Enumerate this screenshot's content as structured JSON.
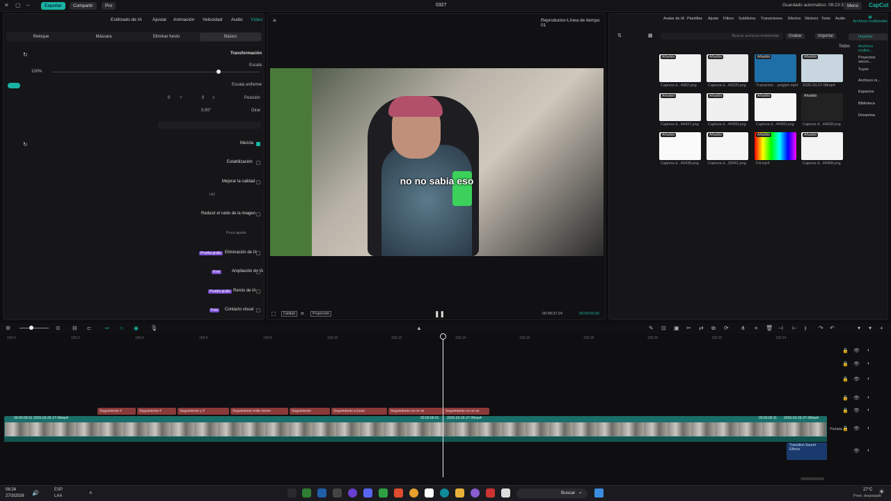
{
  "titlebar": {
    "export": "Exportar",
    "share": "Compartir",
    "pro": "Pro",
    "title": "0327",
    "autosave": "Guardado automático: 08:23:38",
    "menu": "Menú",
    "brand": "CapCut"
  },
  "left_tabs": [
    "Vídeo",
    "Audio",
    "Velocidad",
    "Animación",
    "Ajustar",
    "Estilizado de IA"
  ],
  "left_subtabs": [
    "Básico",
    "Eliminar fondo",
    "Máscara",
    "Retoque"
  ],
  "left": {
    "transform": "Transformación",
    "scale": "Escala",
    "scale_value": "100%",
    "uniform": "Escala uniforme",
    "position": "Posición",
    "pos_x_label": "X",
    "pos_x": "0",
    "pos_y_label": "Y",
    "pos_y": "0",
    "rotate": "Girar",
    "rotate_value": "0.00°",
    "blend": "Mezcla",
    "stabilize": "Estabilización",
    "quality": "Mejorar la calidad",
    "quality_sub": "HD",
    "reduce_noise": "Reducir el ruido de la imagen",
    "noise_sub": "Poco ajuste",
    "ai_remove": "Eliminación de IA",
    "ai_remove_badge": "Prueba gratis",
    "ai_expand": "Ampliación de IA",
    "ai_expand_badge": "Free",
    "ai_remix": "Remix de IA",
    "ai_remix_badge": "Prueba gratis",
    "visual_contact": "Contacto visual",
    "visual_contact_badge": "Free"
  },
  "player": {
    "title": "Reproductor-Línea de tiempo 01",
    "subtitle": "no no sabia eso",
    "time_current": "00:00:06:05",
    "time_total": "00:08:37:24",
    "quality": "Calidad",
    "ratio": "Proporción"
  },
  "media": {
    "tabs": [
      "Importar",
      "Grabar"
    ],
    "search_placeholder": "Buscar archivos multimedia",
    "filter": "Todos",
    "top_tabs": [
      "Archivos multimedia",
      "Audio",
      "Texto",
      "Stickers",
      "Efectos",
      "Transiciones",
      "Subtítulos",
      "Filtros",
      "Ajuste",
      "Plantillas",
      "Avatar de IA"
    ],
    "side": [
      "Importar",
      "Archivos multim...",
      "Proyectos secun...",
      "Tuyos",
      "Archivos m...",
      "Espacios",
      "Biblioteca",
      "Dreamina"
    ],
    "items": [
      {
        "caption": "2026-03-27-08mp4",
        "badge": "Añadido"
      },
      {
        "caption": "Transicion ...pngtpri.mp4",
        "badge": "Añadido"
      },
      {
        "caption": "Captura d...43528.png",
        "badge": "Añadido"
      },
      {
        "caption": "Captura d...4962.png",
        "badge": "Añadido"
      },
      {
        "caption": "Captura d...44608.png",
        "badge": "Añadido"
      },
      {
        "caption": "Captura d...44455.png",
        "badge": "Añadido"
      },
      {
        "caption": "Captura d...44458.png",
        "badge": "Añadido"
      },
      {
        "caption": "Captura d...44437.png",
        "badge": "Añadido"
      },
      {
        "caption": "Captura d...44408.png",
        "badge": "Añadido"
      },
      {
        "caption": "Fili.mp4",
        "badge": "Añadido"
      },
      {
        "caption": "Captura d...30941.png",
        "badge": "Añadido"
      },
      {
        "caption": "Captura d...44438.png",
        "badge": "Añadido"
      }
    ]
  },
  "timeline": {
    "ticks": [
      "100:0",
      "100:2",
      "100:4",
      "100:6",
      "100:8",
      "100:10",
      "100:12",
      "100:14",
      "100:16",
      "100:18",
      "100:20",
      "100:22",
      "100:24"
    ],
    "captions": [
      "Seguimiento #",
      "Seguimiento #",
      "Seguimiento y #",
      "Seguimiento tmlle memo",
      "Seguimiento",
      "Seguimiento si buen",
      "Seguimiento no no ve"
    ],
    "clip_label": "2026-03-26-27-08mp4",
    "clip_time_left": "00:00:09:01",
    "clip_time_mid": "00:00:06:01",
    "clip_time_right": "00:00:05:11",
    "audio_clip": "Transition Sound Effects",
    "cover": "Portada"
  },
  "taskbar": {
    "search": "Buscar",
    "clock": "08:24",
    "date": "27/3/2026",
    "lang": "ESP",
    "lang2": "LAA",
    "weather": "27°C",
    "weather_sub": "Pred. despejado"
  }
}
